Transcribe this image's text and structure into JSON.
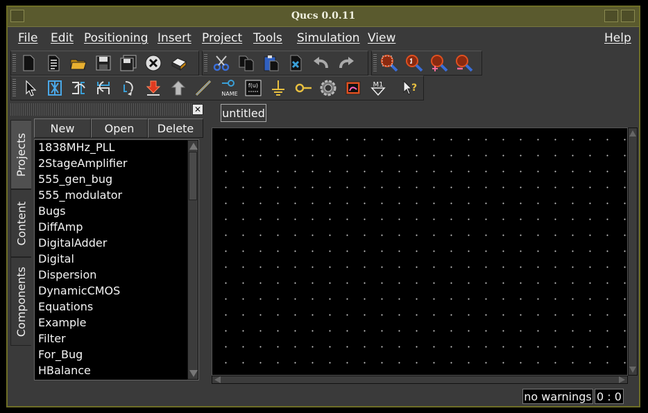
{
  "window": {
    "title": "Qucs 0.0.11"
  },
  "menubar": {
    "items": [
      "File",
      "Edit",
      "Positioning",
      "Insert",
      "Project",
      "Tools",
      "Simulation",
      "View"
    ],
    "help": "Help"
  },
  "toolbar_main": {
    "icons": [
      "new-document-icon",
      "new-text-icon",
      "open-folder-icon",
      "save-icon",
      "save-all-icon",
      "close-icon",
      "print-icon",
      "cut-icon",
      "copy-icon",
      "paste-icon",
      "delete-icon",
      "undo-icon",
      "redo-icon",
      "zoom-fit-icon",
      "zoom-one-icon",
      "zoom-in-icon",
      "zoom-out-icon"
    ]
  },
  "toolbar_tools": {
    "icons": [
      "select-arrow-icon",
      "edit-activate-icon",
      "mirror-x-icon",
      "mirror-y-icon",
      "rotate-icon",
      "move-text-icon",
      "on-grid-icon",
      "wire-icon",
      "label-icon",
      "equation-icon",
      "ground-icon",
      "port-icon",
      "simulate-icon",
      "display-icon",
      "marker-icon",
      "whats-this-icon"
    ],
    "label_text": "NAME",
    "equation_text": "f(u)",
    "marker_text": "M1"
  },
  "dock": {
    "tabs": [
      "Projects",
      "Content",
      "Components"
    ],
    "active_tab": "Projects",
    "buttons": {
      "new": "New",
      "open": "Open",
      "delete": "Delete"
    },
    "projects": [
      "1838MHz_PLL",
      "2StageAmplifier",
      "555_gen_bug",
      "555_modulator",
      "Bugs",
      "DiffAmp",
      "DigitalAdder",
      "Digital",
      "Dispersion",
      "DynamicCMOS",
      "Equations",
      "Example",
      "Filter",
      "For_Bug",
      "HBalance"
    ]
  },
  "document": {
    "tab_label": "untitled"
  },
  "status": {
    "warnings": "no warnings",
    "position": "0 : 0"
  },
  "colors": {
    "frame": "#6e6e26",
    "titlebar": "#5a5a2e",
    "background": "#3a3a3a",
    "canvas": "#000000",
    "grid_dot": "#c8c8c8"
  }
}
